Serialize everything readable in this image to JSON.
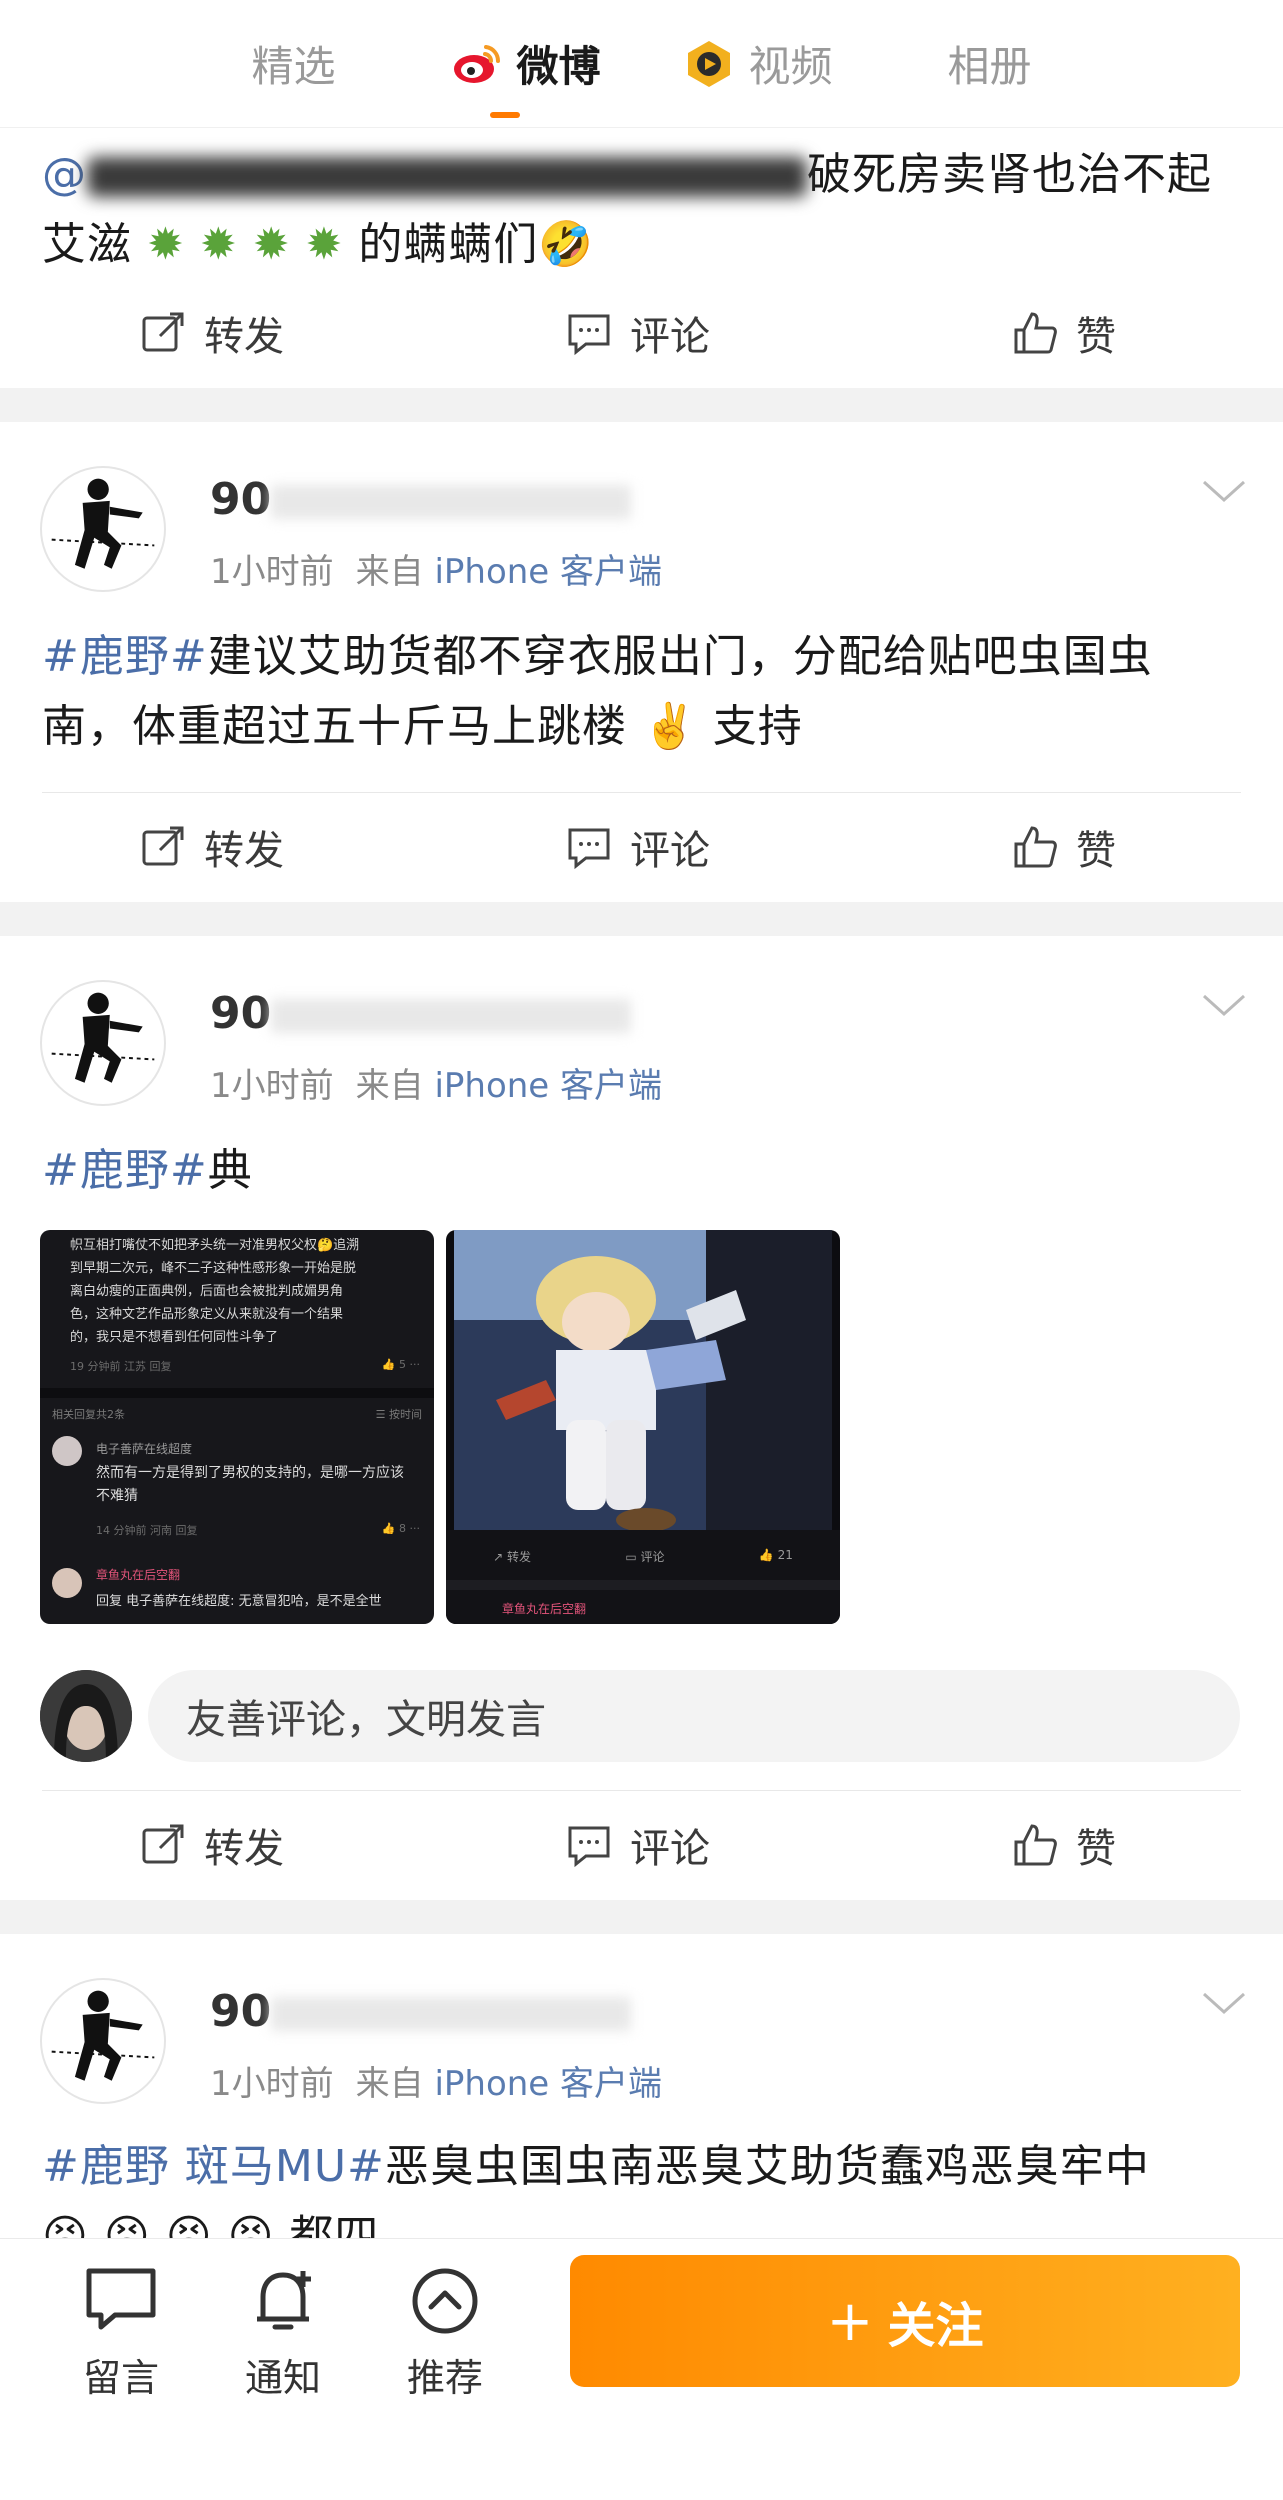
{
  "top_tabs": [
    {
      "label": "精选"
    },
    {
      "label": "微博"
    },
    {
      "label": "视频"
    },
    {
      "label": "相册"
    }
  ],
  "post1": {
    "text_line1_mentions": "@",
    "text_line1_tail": "破死房卖肾也治不起",
    "text_line2": "艾滋",
    "text_line2_tail": "的螨螨们🤣",
    "actions": {
      "repost": "转发",
      "comment": "评论",
      "like": "赞"
    }
  },
  "post2": {
    "username": "90",
    "time": "1小时前",
    "source_prefix": "来自",
    "source": "iPhone 客户端",
    "hashtag": "#鹿野#",
    "text": "建议艾助货都不穿衣服出门，分配给贴吧虫国虫",
    "text2": "南，体重超过五十斤马上跳楼 ✌️ 支持",
    "actions": {
      "repost": "转发",
      "comment": "评论",
      "like": "赞"
    }
  },
  "post3": {
    "username": "90",
    "time": "1小时前",
    "source_prefix": "来自",
    "source": "iPhone 客户端",
    "hashtag": "#鹿野#",
    "text": "典",
    "image1": {
      "lines": [
        "帜互相打嘴仗不如把矛头统一对准男权父权🤔追溯",
        "到早期二次元，峰不二子这种性感形象一开始是脱",
        "离白幼瘦的正面典例，后面也会被批判成媚男角",
        "色，这种文艺作品形象定义从来就没有一个结果",
        "的，我只是不想看到任何同性斗争了"
      ],
      "meta1": "19 分钟前 江苏   回复",
      "likes1": "5",
      "replies_header": "相关回复共2条",
      "sort": "按时间",
      "reply_user": "电子善萨在线超度",
      "reply_text": "然而有一方是得到了男权的支持的，是哪一方应该",
      "reply_text2": "不难猜",
      "meta2": "14 分钟前 河南   回复",
      "likes2": "8",
      "reply2_user": "章鱼丸在后空翻",
      "reply2_text": "回复 电子善萨在线超度: 无意冒犯哈，是不是全世"
    },
    "image2": {
      "repost": "转发",
      "comment": "评论",
      "likes": "21",
      "footer_user": "章鱼丸在后空翻"
    },
    "comment_placeholder": "友善评论，文明发言",
    "actions": {
      "repost": "转发",
      "comment": "评论",
      "like": "赞"
    }
  },
  "post4": {
    "username": "90",
    "time": "1小时前",
    "source_prefix": "来自",
    "source": "iPhone 客户端",
    "hashtag": "#鹿野 斑马MU#",
    "text": "恶臭虫国虫南恶臭艾助货蠢鸡恶臭牢中",
    "text2": "😣 😣 😣 😣 都四"
  },
  "bottom_bar": {
    "message": "留言",
    "notify": "通知",
    "recommend": "推荐",
    "follow": "关注",
    "follow_plus": "+"
  },
  "colors": {
    "accent_orange": "#ff8a00",
    "hashtag_blue": "#4b6ea8",
    "separator_gray": "#f2f2f2"
  }
}
